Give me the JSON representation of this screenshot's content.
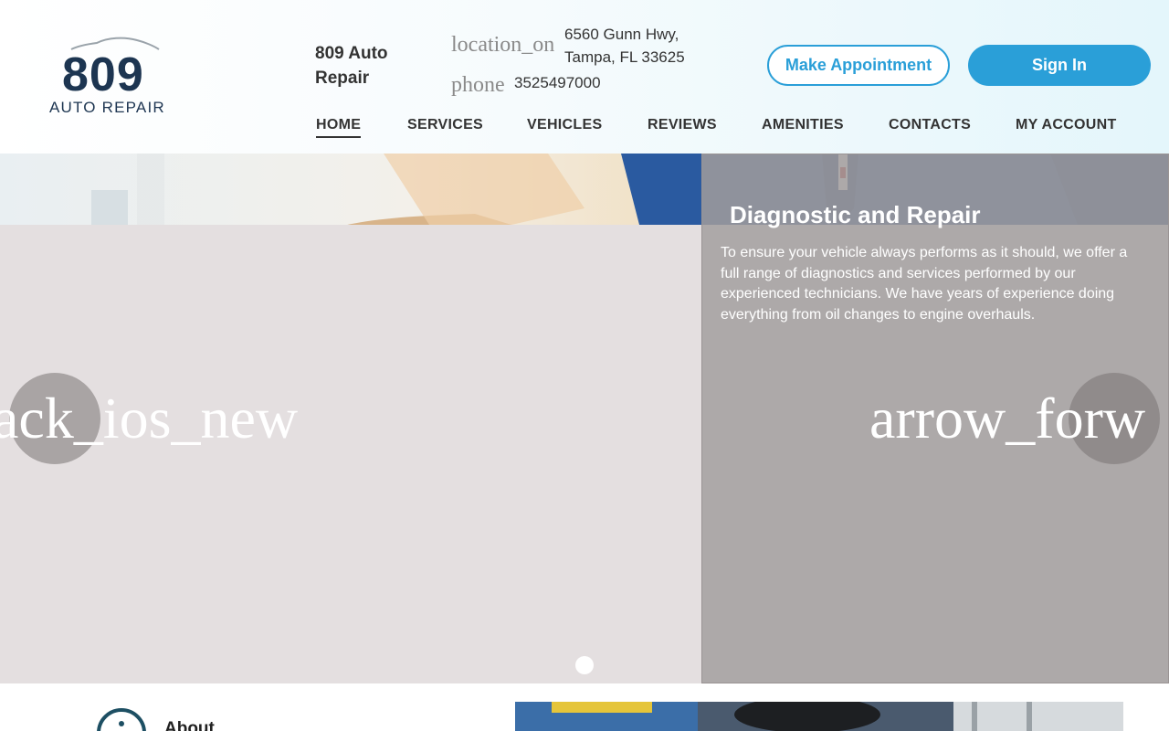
{
  "brand": {
    "logo_number": "809",
    "logo_subtitle": "AUTO REPAIR",
    "business_name": "809 Auto Repair"
  },
  "contact": {
    "location_icon": "location_on",
    "address_line1": "6560 Gunn Hwy,",
    "address_line2": "Tampa, FL 33625",
    "phone_icon": "phone",
    "phone": "3525497000"
  },
  "actions": {
    "appointment_label": "Make Appointment",
    "signin_label": "Sign In"
  },
  "nav": {
    "items": [
      {
        "label": "HOME",
        "active": true
      },
      {
        "label": "SERVICES"
      },
      {
        "label": "VEHICLES"
      },
      {
        "label": "REVIEWS"
      },
      {
        "label": "AMENITIES"
      },
      {
        "label": "CONTACTS"
      },
      {
        "label": "MY ACCOUNT"
      }
    ]
  },
  "hero": {
    "title": "Diagnostic and Repair",
    "description": "To ensure your vehicle always performs as it should, we offer a full range of diagnostics and services performed by our experienced technicians. We have years of experience doing everything from oil changes to engine overhauls.",
    "prev_icon": "ack_ios_new",
    "next_icon": "arrow_forw"
  },
  "section": {
    "about_label": "About"
  },
  "colors": {
    "accent": "#2a9fd8",
    "brand_dark": "#1d3551",
    "text": "#333333"
  },
  "icons": [
    "car-outline-icon",
    "location-icon",
    "phone-icon",
    "arrow-back-icon",
    "arrow-forward-icon",
    "info-icon"
  ]
}
